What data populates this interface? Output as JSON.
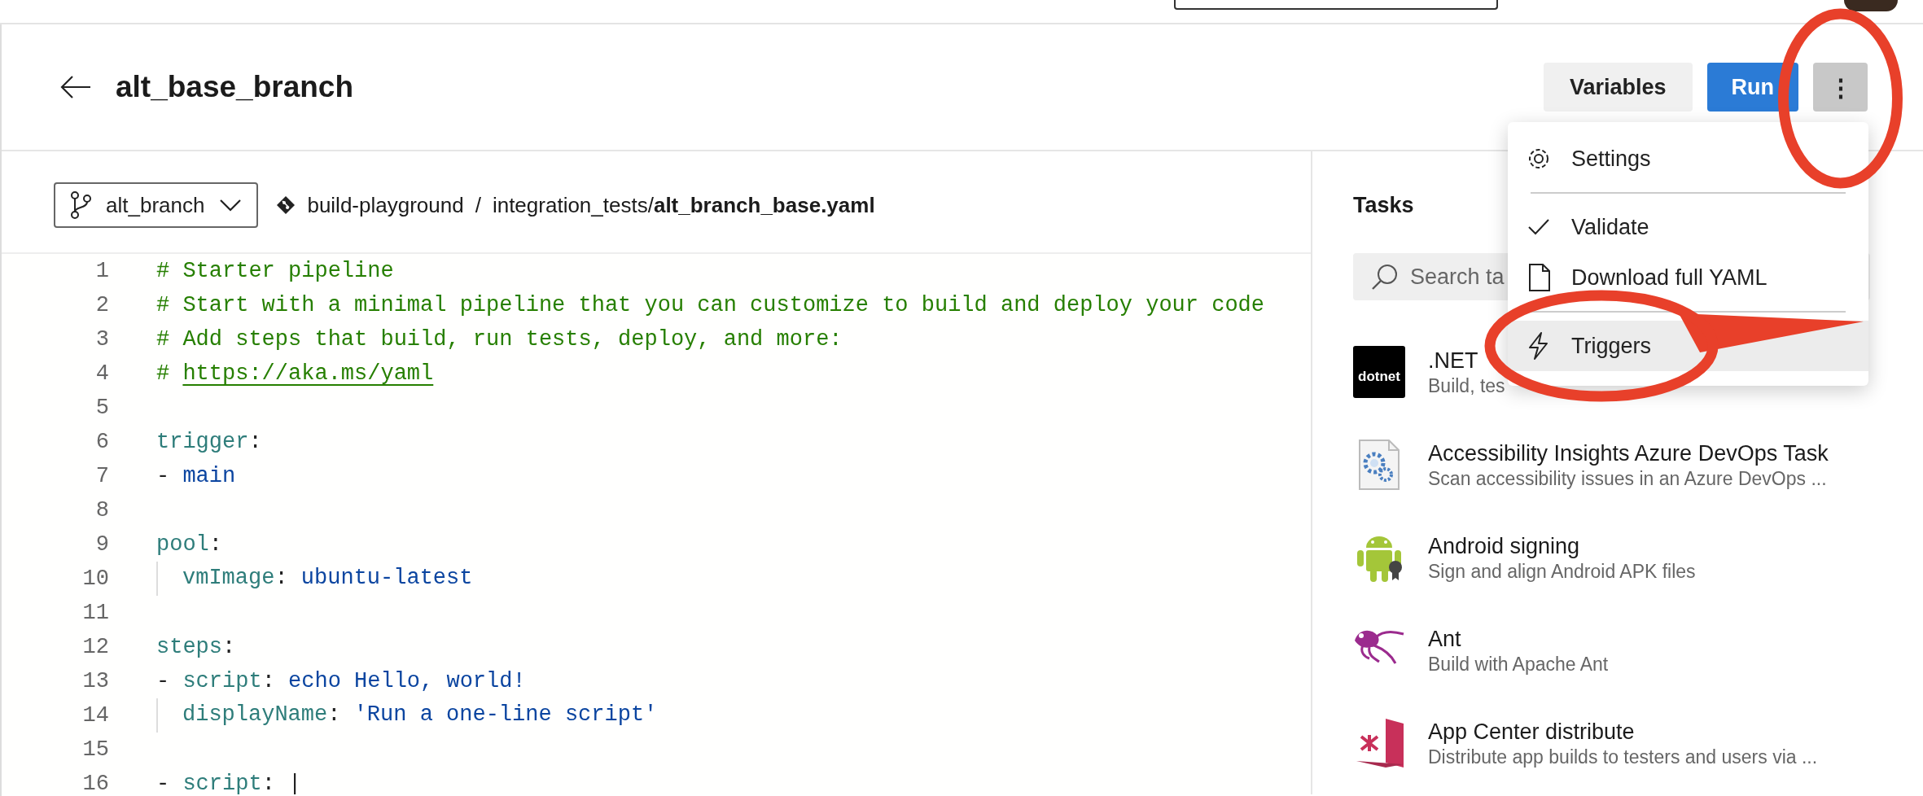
{
  "header": {
    "title": "alt_base_branch",
    "buttons": [
      {
        "kind": "secondary",
        "label": "Variables"
      },
      {
        "kind": "primary",
        "label": "Run"
      },
      {
        "kind": "more",
        "label": "⋮",
        "pressed": true,
        "circled": true
      }
    ]
  },
  "branch_selector": {
    "value": "alt_branch"
  },
  "breadcrumb": {
    "repository": "build-playground",
    "separator": "/",
    "path": "integration_tests/**alt_branch_base.yaml**"
  },
  "editor": {
    "lines": [
      {
        "number": "1",
        "tokens": [
          {
            "kind": "comment",
            "text": "# Starter pipeline"
          }
        ]
      },
      {
        "number": "2",
        "tokens": [
          {
            "kind": "comment",
            "text": "# Start with a minimal pipeline that you can customize to build and deploy your code"
          }
        ]
      },
      {
        "number": "3",
        "tokens": [
          {
            "kind": "comment",
            "text": "# Add steps that build, run tests, deploy, and more:"
          }
        ]
      },
      {
        "number": "4",
        "tokens": [
          {
            "kind": "comment",
            "text": "# "
          },
          {
            "kind": "link",
            "text": "https://aka.ms/yaml"
          }
        ]
      },
      {
        "number": "5"
      },
      {
        "number": "6",
        "tokens": [
          {
            "kind": "key",
            "text": "trigger"
          },
          {
            "kind": "plain",
            "text": ":"
          }
        ]
      },
      {
        "number": "7",
        "tokens": [
          {
            "kind": "plain",
            "text": "- "
          },
          {
            "kind": "value",
            "text": "main"
          }
        ]
      },
      {
        "number": "8"
      },
      {
        "number": "9",
        "tokens": [
          {
            "kind": "key",
            "text": "pool"
          },
          {
            "kind": "plain",
            "text": ":"
          }
        ]
      },
      {
        "number": "10",
        "indent": true,
        "tokens": [
          {
            "kind": "key",
            "text": "vmImage"
          },
          {
            "kind": "plain",
            "text": ": "
          },
          {
            "kind": "value",
            "text": "ubuntu-latest"
          }
        ]
      },
      {
        "number": "11"
      },
      {
        "number": "12",
        "tokens": [
          {
            "kind": "key",
            "text": "steps"
          },
          {
            "kind": "plain",
            "text": ":"
          }
        ]
      },
      {
        "number": "13",
        "tokens": [
          {
            "kind": "plain",
            "text": "- "
          },
          {
            "kind": "key",
            "text": "script"
          },
          {
            "kind": "plain",
            "text": ": "
          },
          {
            "kind": "value",
            "text": "echo Hello, world!"
          }
        ]
      },
      {
        "number": "14",
        "indent": true,
        "tokens": [
          {
            "kind": "key",
            "text": "displayName"
          },
          {
            "kind": "plain",
            "text": ": "
          },
          {
            "kind": "value",
            "text": "'Run a one-line script'"
          }
        ]
      },
      {
        "number": "15"
      },
      {
        "number": "16",
        "tokens": [
          {
            "kind": "plain",
            "text": "- "
          },
          {
            "kind": "key",
            "text": "script"
          },
          {
            "kind": "plain",
            "text": ": "
          },
          {
            "kind": "plain",
            "text": "|"
          }
        ]
      }
    ]
  },
  "tasks": {
    "title": "Tasks",
    "search": {
      "placeholder": "Search ta"
    },
    "items": [
      {
        "title": ".NET",
        "description": "Build, tes",
        "logo_text": "dotnet"
      },
      {
        "title": "Accessibility Insights Azure DevOps Task",
        "description": "Scan accessibility issues in an Azure DevOps ..."
      },
      {
        "title": "Android signing",
        "description": "Sign and align Android APK files"
      },
      {
        "title": "Ant",
        "description": "Build with Apache Ant"
      },
      {
        "title": "App Center distribute",
        "description": "Distribute app builds to testers and users via ..."
      }
    ]
  },
  "menu": {
    "groups": [
      [
        {
          "label": "Settings",
          "hovered": false
        }
      ],
      [
        {
          "label": "Validate",
          "hovered": false
        },
        {
          "label": "Download full YAML",
          "hovered": false
        }
      ],
      [
        {
          "label": "Triggers",
          "hovered": true,
          "circled": true
        }
      ]
    ]
  }
}
